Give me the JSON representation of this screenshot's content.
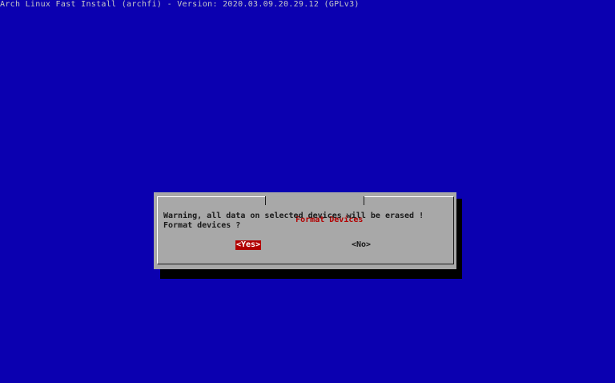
{
  "backtitle": "Arch Linux Fast Install (archfi) - Version: 2020.03.09.20.29.12 (GPLv3)",
  "dialog": {
    "title": "Format Devices",
    "message_lines": [
      "Warning, all data on selected devices will be erased !",
      "Format devices ?"
    ],
    "buttons": {
      "yes_label": "<Yes>",
      "no_label": "<No>",
      "selected": "yes"
    }
  },
  "colors": {
    "background": "#0b00b0",
    "dialog": "#a8a8a8",
    "shadow": "#000000",
    "accent": "#b20000",
    "text": "#1a1a1a"
  }
}
